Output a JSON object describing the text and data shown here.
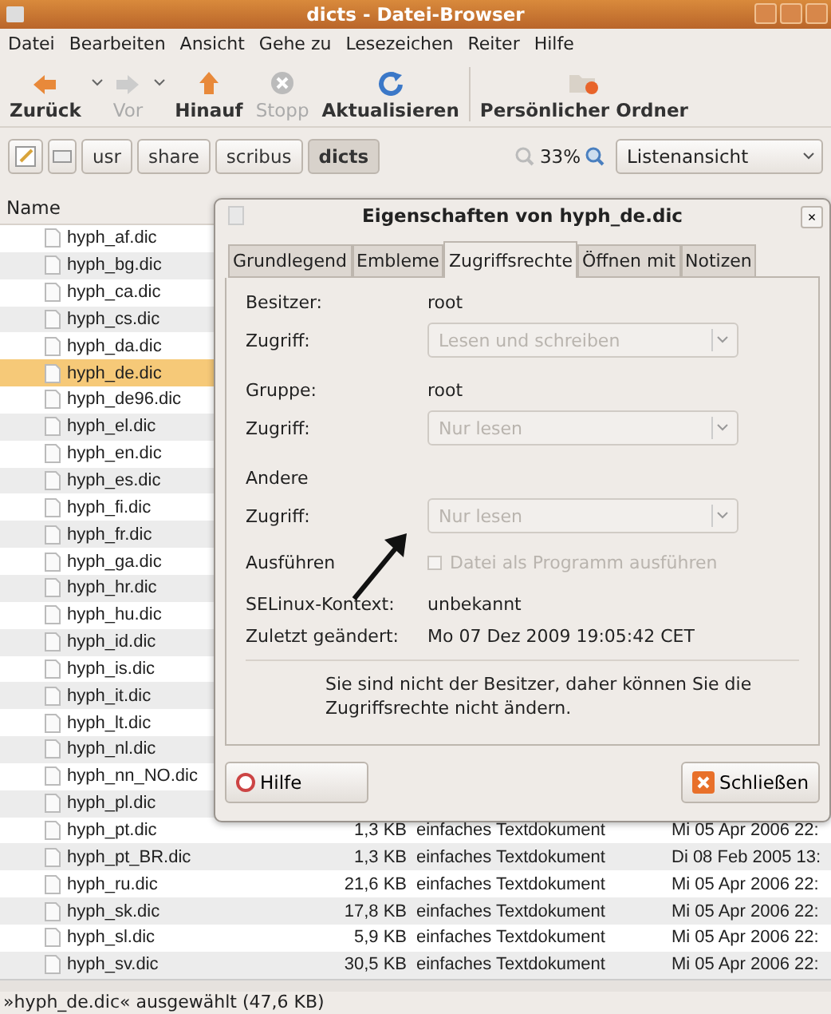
{
  "window": {
    "title": "dicts - Datei-Browser"
  },
  "menu": [
    "Datei",
    "Bearbeiten",
    "Ansicht",
    "Gehe zu",
    "Lesezeichen",
    "Reiter",
    "Hilfe"
  ],
  "toolbar": [
    {
      "label": "Zurück",
      "kind": "back",
      "disabled": false,
      "dropdown": true
    },
    {
      "label": "Vor",
      "kind": "forward",
      "disabled": true,
      "dropdown": true
    },
    {
      "label": "Hinauf",
      "kind": "up",
      "disabled": false,
      "dropdown": false
    },
    {
      "label": "Stopp",
      "kind": "stop",
      "disabled": true,
      "dropdown": false
    },
    {
      "label": "Aktualisieren",
      "kind": "reload",
      "disabled": false,
      "dropdown": false
    },
    {
      "label": "Persönlicher Ordner",
      "kind": "home",
      "disabled": false,
      "dropdown": false
    }
  ],
  "pathbar": {
    "crumbs": [
      {
        "label": "usr",
        "selected": false
      },
      {
        "label": "share",
        "selected": false
      },
      {
        "label": "scribus",
        "selected": false
      },
      {
        "label": "dicts",
        "selected": true
      }
    ],
    "zoom": "33%",
    "view": "Listenansicht"
  },
  "list": {
    "columns": [
      "Name"
    ],
    "rows": [
      {
        "name": "hyph_af.dic",
        "selected": false
      },
      {
        "name": "hyph_bg.dic",
        "selected": false
      },
      {
        "name": "hyph_ca.dic",
        "selected": false
      },
      {
        "name": "hyph_cs.dic",
        "selected": false
      },
      {
        "name": "hyph_da.dic",
        "selected": false
      },
      {
        "name": "hyph_de.dic",
        "selected": true
      },
      {
        "name": "hyph_de96.dic",
        "selected": false
      },
      {
        "name": "hyph_el.dic",
        "selected": false
      },
      {
        "name": "hyph_en.dic",
        "selected": false
      },
      {
        "name": "hyph_es.dic",
        "selected": false
      },
      {
        "name": "hyph_fi.dic",
        "selected": false
      },
      {
        "name": "hyph_fr.dic",
        "selected": false
      },
      {
        "name": "hyph_ga.dic",
        "selected": false
      },
      {
        "name": "hyph_hr.dic",
        "selected": false
      },
      {
        "name": "hyph_hu.dic",
        "selected": false
      },
      {
        "name": "hyph_id.dic",
        "selected": false
      },
      {
        "name": "hyph_is.dic",
        "selected": false
      },
      {
        "name": "hyph_it.dic",
        "selected": false
      },
      {
        "name": "hyph_lt.dic",
        "selected": false
      },
      {
        "name": "hyph_nl.dic",
        "selected": false
      },
      {
        "name": "hyph_nn_NO.dic",
        "selected": false
      },
      {
        "name": "hyph_pl.dic",
        "selected": false
      },
      {
        "name": "hyph_pt.dic",
        "selected": false,
        "size": "1,3 KB",
        "type": "einfaches Textdokument",
        "date": "Mi 05 Apr 2006 22:"
      },
      {
        "name": "hyph_pt_BR.dic",
        "selected": false,
        "size": "1,3 KB",
        "type": "einfaches Textdokument",
        "date": "Di 08 Feb 2005 13:"
      },
      {
        "name": "hyph_ru.dic",
        "selected": false,
        "size": "21,6 KB",
        "type": "einfaches Textdokument",
        "date": "Mi 05 Apr 2006 22:"
      },
      {
        "name": "hyph_sk.dic",
        "selected": false,
        "size": "17,8 KB",
        "type": "einfaches Textdokument",
        "date": "Mi 05 Apr 2006 22:"
      },
      {
        "name": "hyph_sl.dic",
        "selected": false,
        "size": "5,9 KB",
        "type": "einfaches Textdokument",
        "date": "Mi 05 Apr 2006 22:"
      },
      {
        "name": "hyph_sv.dic",
        "selected": false,
        "size": "30,5 KB",
        "type": "einfaches Textdokument",
        "date": "Mi 05 Apr 2006 22:"
      }
    ]
  },
  "dialog": {
    "title": "Eigenschaften von hyph_de.dic",
    "close": "×",
    "tabs": [
      {
        "label": "Grundlegend",
        "selected": false
      },
      {
        "label": "Embleme",
        "selected": false
      },
      {
        "label": "Zugriffsrechte",
        "selected": true
      },
      {
        "label": "Öffnen mit",
        "selected": false
      },
      {
        "label": "Notizen",
        "selected": false
      }
    ],
    "sections": [
      {
        "kind": "value",
        "label": "Besitzer:",
        "value": "root"
      },
      {
        "kind": "select",
        "label": "Zugriff:",
        "value": "Lesen und schreiben",
        "disabled": true
      },
      {
        "kind": "value",
        "label": "Gruppe:",
        "value": "root"
      },
      {
        "kind": "select",
        "label": "Zugriff:",
        "value": "Nur lesen",
        "disabled": true
      },
      {
        "kind": "heading",
        "label": "Andere"
      },
      {
        "kind": "select",
        "label": "Zugriff:",
        "value": "Nur lesen",
        "disabled": true
      },
      {
        "kind": "checkbox",
        "label": "Ausführen",
        "value": "Datei als Programm ausführen",
        "checked": false,
        "disabled": true
      },
      {
        "kind": "info",
        "label": "SELinux-Kontext:",
        "value": "unbekannt"
      },
      {
        "kind": "info",
        "label": "Zuletzt geändert:",
        "value": "Mo 07 Dez 2009 19:05:42 CET"
      }
    ],
    "notice": "Sie sind nicht der Besitzer, daher können Sie die Zugriffsrechte nicht ändern.",
    "buttons": [
      {
        "label": "Hilfe",
        "kind": "help"
      },
      {
        "label": "Schließen",
        "kind": "close"
      }
    ]
  },
  "status_bar": "»hyph_de.dic« ausgewählt (47,6 KB)"
}
